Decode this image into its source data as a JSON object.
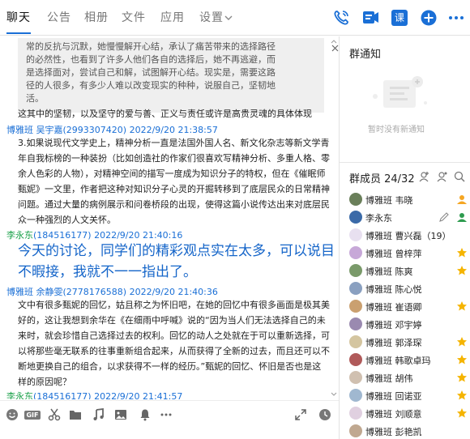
{
  "tabs": [
    "聊天",
    "公告",
    "相册",
    "文件",
    "应用",
    "设置"
  ],
  "header_icons": [
    "phone-icon",
    "video-icon",
    "classroom-icon",
    "add-icon",
    "more-icon"
  ],
  "header_class_label": "课",
  "chat": {
    "quote_lines": [
      "常的反抗与沉默，她慢慢解开心结，承认了痛苦带来的选择路径",
      "的必然性，也看到了许多人他们各自的选择后，她不再逃避，而",
      "是选择面对，尝试自己和解，试图解开心结。现实是，需要这路",
      "径的人很多，有多少人难以改变现实的种种，说服自己，坚韧地",
      "活。"
    ],
    "line_after_quote": "这其中的坚韧，以及坚守的爱与善、正义与责任或许是高贵灵魂的具体体现",
    "messages": [
      {
        "sender": "博雅班 吴宇嘉",
        "qq": "(2993307420)",
        "time": "2022/9/20 21:38:57",
        "lines": [
          "3.如果说现代文学史上，精神分析一直是法国外国人名、新文化杂志等新文学青",
          "年自我标榜的一种装扮（比如创造社的作家们很喜欢写精神分析、多重人格、零",
          "余人色彩的人物），对精神空间的描写一度成为知识分子的特权，但在《催眠师",
          "甄妮》一文里，作者把这种对知识分子心灵的开掘转移到了底层民众的日常精神",
          "问题。通过大量的病例展示和问卷桥段的出现，使得这篇小说传达出来对底层民",
          "众一种强烈的人文关怀。"
        ]
      },
      {
        "sender": "李永东",
        "qq": "(184516177)",
        "time": "2022/9/20 21:40:16",
        "lines": [
          "今天的讨论，同学们的精彩观点实在太多，可以说目",
          "不暇接，我就不一一指出了。"
        ]
      },
      {
        "sender": "博雅班 余静雯",
        "qq": "(2778176588)",
        "time": "2022/9/20 21:40:36",
        "lines": [
          "文中有很多甄妮的回忆，姑且称之为怀旧吧，在她的回忆中有很多画面是极其美",
          "好的，这让我想到余华在《在细雨中呼喊》说的“因为当人们无法选择自己的未",
          "来时，就会珍惜自己选择过去的权利。回忆的动人之处就在于可以重新选择，可",
          "以将那些毫无联系的往事重新组合起来，从而获得了全新的过去，而且还可以不",
          "断地更换自己的组合，以求获得不一样的经历。”甄妮的回忆、怀旧是否也是这",
          "样的原因呢？"
        ]
      },
      {
        "sender": "李永东",
        "qq": "(184516177)",
        "time": "2022/9/20 21:41:57",
        "lines": []
      }
    ]
  },
  "toolbar_icons": [
    "emoji-icon",
    "gif-icon",
    "scissors-icon",
    "folder-icon",
    "music-icon",
    "image-icon",
    "bell-icon",
    "more-icon",
    "expand-icon",
    "history-icon"
  ],
  "toolbar_gif_label": "GIF",
  "notice": {
    "title": "群通知",
    "empty_text": "暂时没有新通知"
  },
  "members": {
    "title": "群成员 24/32",
    "list": [
      {
        "name": "博雅班 韦晓",
        "badge": "owner",
        "color": "#6a7f5a"
      },
      {
        "name": "李永东",
        "badge": "admin-edit",
        "color": "#3b6aa8"
      },
      {
        "name": "博雅班 曹兴磊（19）",
        "badge": "",
        "color": "#e8e0f0"
      },
      {
        "name": "博雅班 曾梓萍",
        "badge": "star",
        "color": "#c7a8d8"
      },
      {
        "name": "博雅班 陈爽",
        "badge": "star",
        "color": "#7a9a6a"
      },
      {
        "name": "博雅班 陈心悦",
        "badge": "",
        "color": "#8aa0c0"
      },
      {
        "name": "博雅班 崔语卿",
        "badge": "star",
        "color": "#caa070"
      },
      {
        "name": "博雅班 邓宇婷",
        "badge": "",
        "color": "#9a8ab0"
      },
      {
        "name": "博雅班 郭泽琛",
        "badge": "star",
        "color": "#d4c5a0"
      },
      {
        "name": "博雅班 韩歌卓玛",
        "badge": "star",
        "color": "#b05a5a"
      },
      {
        "name": "博雅班 胡伟",
        "badge": "star",
        "color": "#d0c0b0"
      },
      {
        "name": "博雅班 回诺亚",
        "badge": "star",
        "color": "#a0b8d0"
      },
      {
        "name": "博雅班 刘顺意",
        "badge": "star",
        "color": "#e0d0e0"
      },
      {
        "name": "博雅班 彭艳凯",
        "badge": "",
        "color": "#c0a890"
      }
    ]
  },
  "colors": {
    "accent": "#1a6fd6",
    "sender_green": "#1aa049",
    "star": "#f5b400"
  }
}
